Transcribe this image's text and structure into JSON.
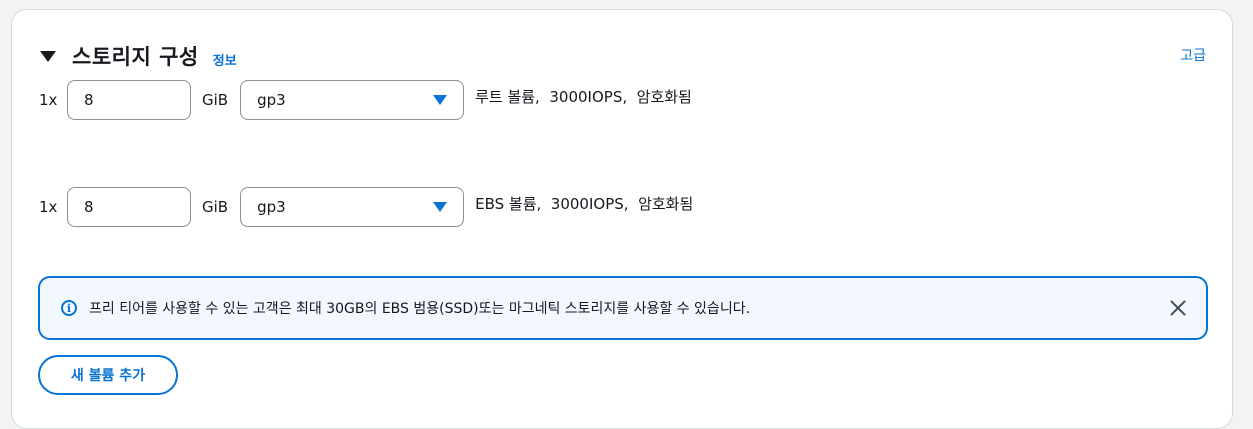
{
  "section": {
    "title": "스토리지 구성",
    "info_link": "정보",
    "advanced_link": "고급"
  },
  "volumes": [
    {
      "quantity": "1x",
      "size": "8",
      "unit": "GiB",
      "type": "gp3",
      "description": "루트 볼륨,  3000IOPS,  암호화됨"
    },
    {
      "quantity": "1x",
      "size": "8",
      "unit": "GiB",
      "type": "gp3",
      "description": "EBS 볼륨,  3000IOPS,  암호화됨"
    }
  ],
  "alert": {
    "icon": "info-icon",
    "text": "프리 티어를 사용할 수 있는 고객은 최대 30GB의 EBS 범용(SSD)또는 마그네틱 스토리지를 사용할 수 있습니다."
  },
  "add_volume_button": "새 볼륨 추가",
  "colors": {
    "accent": "#0972d3",
    "alert_bg": "#f2f8fd",
    "text": "#16191f"
  }
}
